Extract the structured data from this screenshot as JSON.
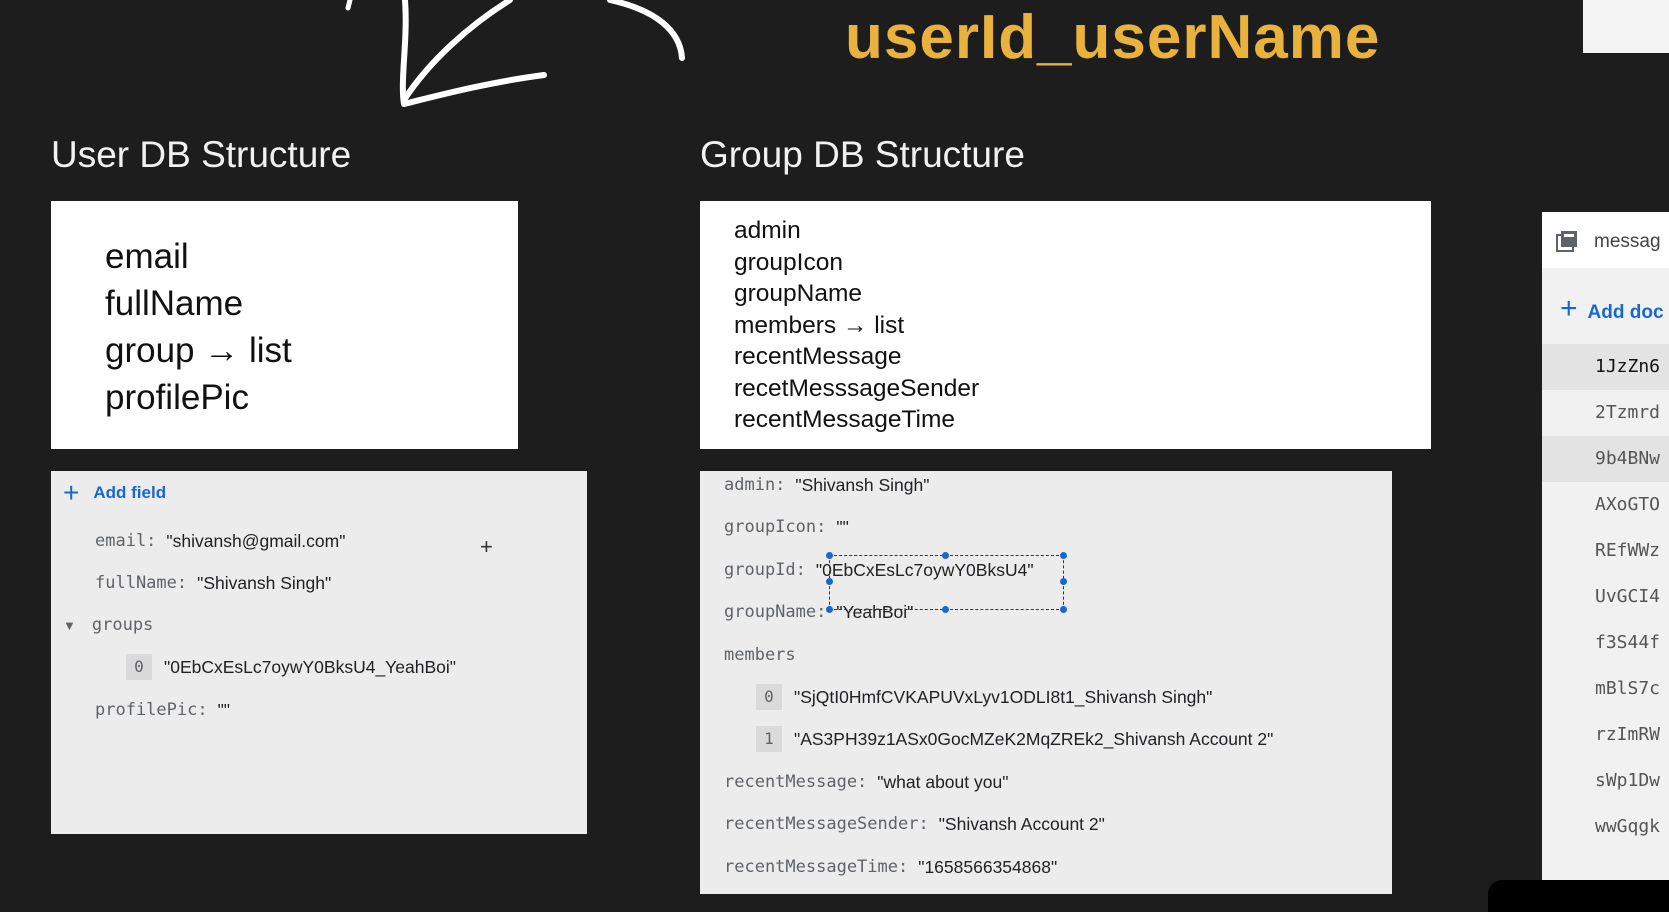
{
  "slide": {
    "top_title": "userId_userName",
    "user_heading": "User DB Structure",
    "group_heading": "Group DB Structure"
  },
  "user_schema": [
    "email",
    "fullName",
    "group → list",
    "profilePic"
  ],
  "group_schema": [
    "admin",
    "groupIcon",
    "groupName",
    "members → list",
    "recentMessage",
    "recetMesssageSender",
    "recentMessageTime"
  ],
  "user_doc": {
    "add_field": "Add field",
    "email_key": "email:",
    "email_val": "\"shivansh@gmail.com\"",
    "fullname_key": "fullName:",
    "fullname_val": "\"Shivansh Singh\"",
    "groups_key": "groups",
    "groups_idx": "0",
    "groups_val": "\"0EbCxEsLc7oywY0BksU4_YeahBoi\"",
    "profilepic_key": "profilePic:",
    "profilepic_val": "\"\""
  },
  "group_doc": {
    "admin_key": "admin:",
    "admin_val": "\"Shivansh Singh\"",
    "groupicon_key": "groupIcon:",
    "groupicon_val": "\"\"",
    "groupid_key": "groupId:",
    "groupid_val": "\"0EbCxEsLc7oywY0BksU4\"",
    "groupname_key": "groupName:",
    "groupname_val": "\"YeahBoi\"",
    "members_key": "members",
    "member0_idx": "0",
    "member0_val": "\"SjQtI0HmfCVKAPUVxLyv1ODLI8t1_Shivansh Singh\"",
    "member1_idx": "1",
    "member1_val": "\"AS3PH39z1ASx0GocMZeK2MqZREk2_Shivansh Account 2\"",
    "recentmessage_key": "recentMessage:",
    "recentmessage_val": "\"what about you\"",
    "recentsender_key": "recentMessageSender:",
    "recentsender_val": "\"Shivansh Account 2\"",
    "recenttime_key": "recentMessageTime:",
    "recenttime_val": "\"1658566354868\""
  },
  "collection_panel": {
    "header": "messag",
    "add_document": "Add doc",
    "documents": [
      "1JzZn6",
      "2Tzmrd",
      "9b4BNw",
      "AXoGTO",
      "REfWWz",
      "UvGCI4",
      "f3S44f",
      "mBlS7c",
      "rzImRW",
      "sWp1Dw",
      "wwGqgk"
    ]
  },
  "colors": {
    "background": "#1d1d1d",
    "title_accent": "#e8b23c",
    "link_blue": "#1a67d2"
  }
}
